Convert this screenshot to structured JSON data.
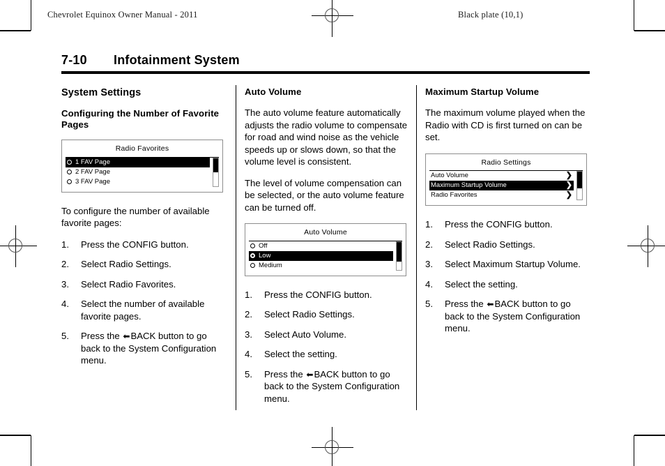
{
  "runhead": {
    "left": "Chevrolet Equinox Owner Manual - 2011",
    "right": "Black plate (10,1)"
  },
  "page_title": {
    "number": "7-10",
    "text": "Infotainment System"
  },
  "icons": {
    "back_arrow": "⬅",
    "chevron_right": "❯"
  },
  "columns": {
    "col1": {
      "section_heading": "System Settings",
      "sub_heading": "Configuring the Number of Favorite Pages",
      "display": {
        "title": "Radio Favorites",
        "rows": [
          {
            "label": "1 FAV Page",
            "selected": false,
            "highlighted": true
          },
          {
            "label": "2 FAV Page",
            "selected": false,
            "highlighted": false
          },
          {
            "label": "3 FAV Page",
            "selected": false,
            "highlighted": false
          }
        ]
      },
      "intro": "To configure the number of available favorite pages:",
      "steps": [
        {
          "num": "1.",
          "pre": "Press the CONFIG button.",
          "arrow": false,
          "post": ""
        },
        {
          "num": "2.",
          "pre": "Select Radio Settings.",
          "arrow": false,
          "post": ""
        },
        {
          "num": "3.",
          "pre": "Select Radio Favorites.",
          "arrow": false,
          "post": ""
        },
        {
          "num": "4.",
          "pre": "Select the number of available favorite pages.",
          "arrow": false,
          "post": ""
        },
        {
          "num": "5.",
          "pre": "Press the ",
          "arrow": true,
          "post": "BACK button to go back to the System Configuration menu."
        }
      ]
    },
    "col2": {
      "section_heading": "Auto Volume",
      "paragraphs": [
        "The auto volume feature automatically adjusts the radio volume to compensate for road and wind noise as the vehicle speeds up or slows down, so that the volume level is consistent.",
        "The level of volume compensation can be selected, or the auto volume feature can be turned off."
      ],
      "display": {
        "title": "Auto Volume",
        "rows": [
          {
            "label": "Off",
            "selected": false,
            "highlighted": false
          },
          {
            "label": "Low",
            "selected": true,
            "highlighted": true
          },
          {
            "label": "Medium",
            "selected": false,
            "highlighted": false
          }
        ]
      },
      "steps": [
        {
          "num": "1.",
          "pre": "Press the CONFIG button.",
          "arrow": false,
          "post": ""
        },
        {
          "num": "2.",
          "pre": "Select Radio Settings.",
          "arrow": false,
          "post": ""
        },
        {
          "num": "3.",
          "pre": "Select Auto Volume.",
          "arrow": false,
          "post": ""
        },
        {
          "num": "4.",
          "pre": "Select the setting.",
          "arrow": false,
          "post": ""
        },
        {
          "num": "5.",
          "pre": "Press the ",
          "arrow": true,
          "post": "BACK button to go back to the System Configuration menu."
        }
      ]
    },
    "col3": {
      "section_heading": "Maximum Startup Volume",
      "paragraphs": [
        "The maximum volume played when the Radio with CD is first turned on can be set."
      ],
      "display": {
        "title": "Radio Settings",
        "rows": [
          {
            "label": "Auto Volume",
            "chevron": true,
            "highlighted": false
          },
          {
            "label": "Maximum Startup Volume",
            "chevron": true,
            "highlighted": true
          },
          {
            "label": "Radio Favorites",
            "chevron": true,
            "highlighted": false
          }
        ]
      },
      "steps": [
        {
          "num": "1.",
          "pre": "Press the CONFIG button.",
          "arrow": false,
          "post": ""
        },
        {
          "num": "2.",
          "pre": "Select Radio Settings.",
          "arrow": false,
          "post": ""
        },
        {
          "num": "3.",
          "pre": "Select Maximum Startup Volume.",
          "arrow": false,
          "post": ""
        },
        {
          "num": "4.",
          "pre": "Select the setting.",
          "arrow": false,
          "post": ""
        },
        {
          "num": "5.",
          "pre": "Press the ",
          "arrow": true,
          "post": "BACK button to go back to the System Configuration menu."
        }
      ]
    }
  }
}
